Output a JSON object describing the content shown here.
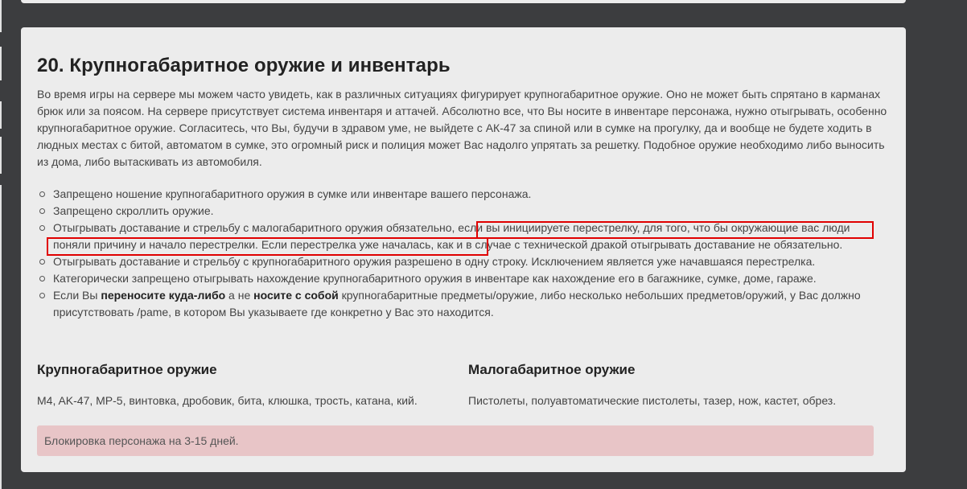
{
  "section": {
    "title": "20. Крупногабаритное оружие и инвентарь",
    "intro": "Во время игры на сервере мы можем часто увидеть, как в различных ситуациях фигурирует крупногабаритное оружие. Оно не может быть спрятано в карманах брюк или за поясом. На сервере присутствует система инвентаря и аттачей. Абсолютно все, что Вы носите в инвентаре персонажа, нужно отыгрывать, особенно крупногабаритное оружие. Согласитесь, что Вы, будучи в здравом уме, не выйдете с АК-47 за спиной или в сумке на прогулку, да и вообще не будете ходить в людных местах с битой, автоматом в сумке, это огромный риск и полиция может Вас надолго упрятать за решетку. Подобное оружие необходимо либо выносить из дома, либо вытаскивать из автомобиля.",
    "rules": {
      "r1": "Запрещено ношение крупногабаритного оружия в сумке или инвентаре вашего персонажа.",
      "r2": "Запрещено скроллить оружие.",
      "r3": "Отыгрывать доставание и стрельбу с малогабаритного оружия обязательно, если вы инициируете перестрелку, для того, что бы окружающие вас люди поняли причину и начало перестрелки. Если перестрелка уже началась, как и в случае с технической дракой отыгрывать доставание не обязательно.",
      "r4": "Отыгрывать доставание и стрельбу с крупногабаритного оружия разрешено в одну строку. Исключением является уже начавшаяся перестрелка.",
      "r5": "Категорически запрещено отыгрывать нахождение крупногабаритного оружия в инвентаре как нахождение его в багажнике, сумке, доме, гараже.",
      "r6_a": "Если Вы ",
      "r6_b": "переносите куда-либо",
      "r6_c": " а не ",
      "r6_d": "носите с собой",
      "r6_e": " крупногабаритные предметы/оружие, либо несколько небольших предметов/оружий, у Вас должно присутствовать /pame, в котором Вы указываете где конкретно у Вас это находится."
    },
    "large": {
      "title": "Крупногабаритное оружие",
      "items": "M4, AK-47, MP-5, винтовка, дробовик, бита, клюшка, трость, катана, кий."
    },
    "small": {
      "title": "Малогабаритное оружие",
      "items": "Пистолеты, полуавтоматические пистолеты, тазер, нож, кастет, обрез."
    },
    "penalty": "Блокировка персонажа на 3-15 дней."
  },
  "colors": {
    "background": "#3c3d3f",
    "card": "#ececec",
    "highlight": "#e00000",
    "alert": "#e8c5c7"
  }
}
